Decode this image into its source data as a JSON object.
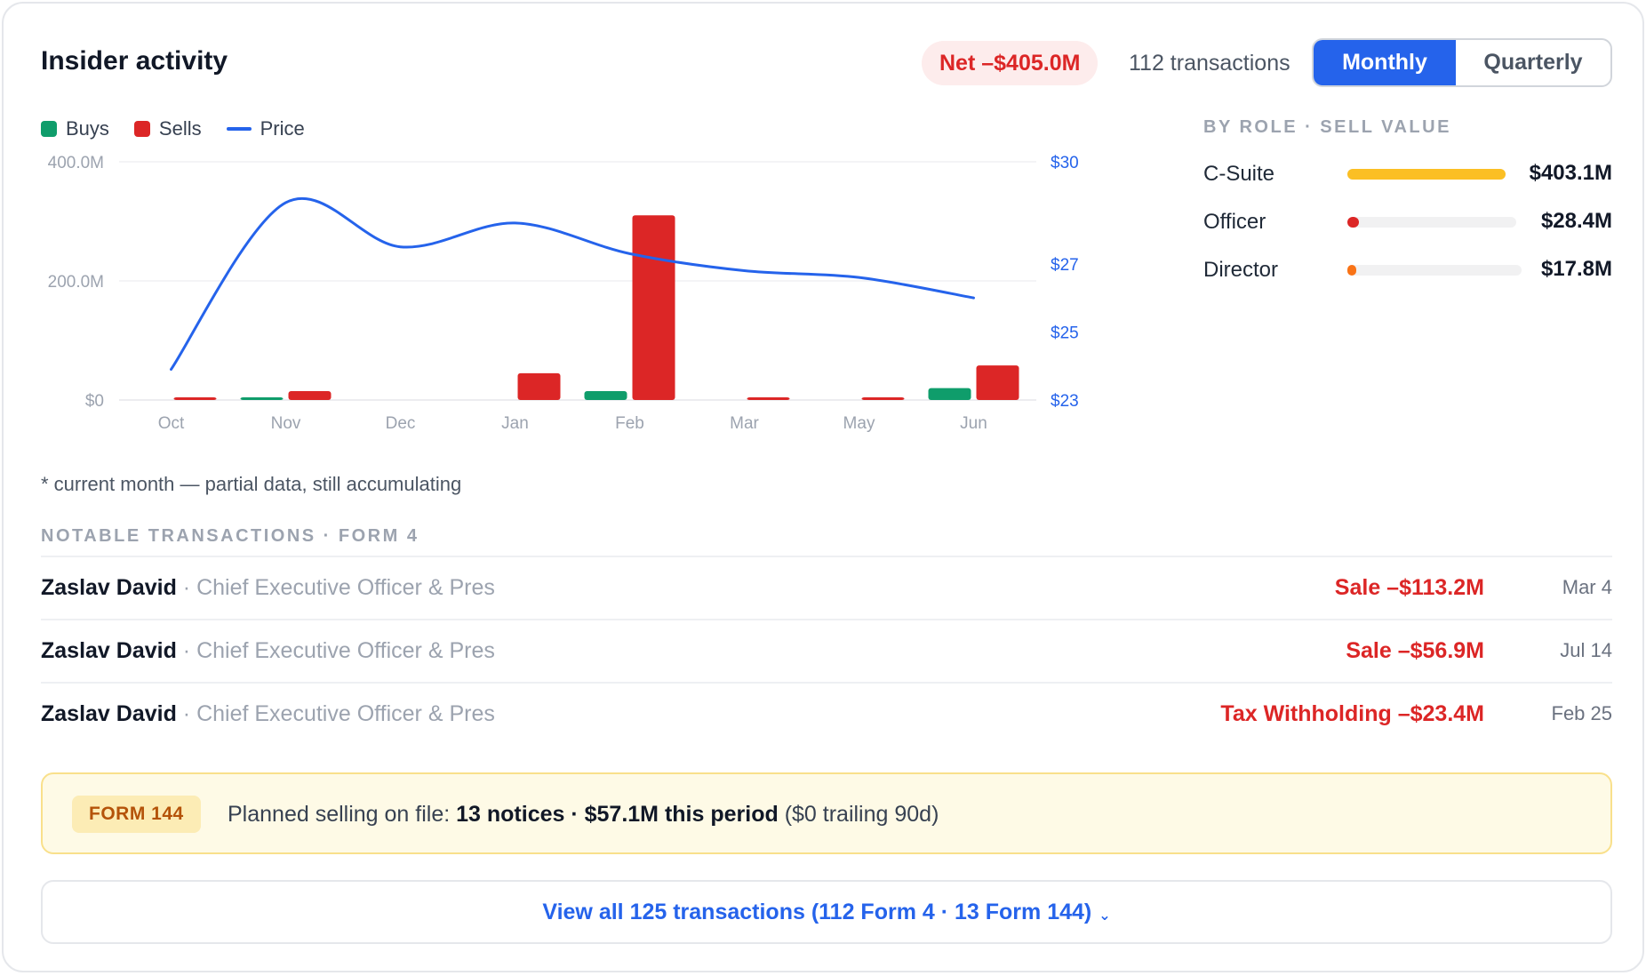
{
  "header": {
    "title": "Insider activity",
    "net": "Net –$405.0M",
    "transactions": "112 transactions",
    "toggle": {
      "active": "Monthly",
      "inactive": "Quarterly"
    }
  },
  "legend": {
    "buys": "Buys",
    "sells": "Sells",
    "price": "Price"
  },
  "chart_data": {
    "type": "bar",
    "categories": [
      "Oct",
      "Nov",
      "Dec",
      "Jan",
      "Feb",
      "Mar",
      "May",
      "Jun"
    ],
    "series": [
      {
        "name": "Buys",
        "color": "#0f9d6b",
        "values": [
          0,
          3,
          0,
          0,
          15,
          0,
          0,
          20
        ]
      },
      {
        "name": "Sells",
        "color": "#dc2626",
        "values": [
          3,
          15,
          0,
          45,
          310,
          4,
          4,
          58
        ]
      }
    ],
    "line": {
      "name": "Price",
      "color": "#2563eb",
      "values": [
        23.9,
        28.8,
        27.5,
        28.2,
        27.3,
        26.8,
        26.6,
        26.0
      ]
    },
    "y_left": {
      "ticks": [
        "400.0M",
        "200.0M",
        "$0"
      ],
      "ylim": [
        0,
        400
      ]
    },
    "y_right": {
      "ticks": [
        "$30",
        "$27",
        "$25",
        "$23"
      ]
    },
    "grid": true,
    "legend_position": "top-left"
  },
  "footnote": "* current month — partial data, still accumulating",
  "by_role": {
    "heading": "BY ROLE · SELL VALUE",
    "rows": [
      {
        "name": "C-Suite",
        "value": "$403.1M",
        "share": 1.0,
        "color": "#fbbf24"
      },
      {
        "name": "Officer",
        "value": "$28.4M",
        "share": 0.07,
        "color": "#dc2626"
      },
      {
        "name": "Director",
        "value": "$17.8M",
        "share": 0.044,
        "color": "#f97316"
      }
    ]
  },
  "notable": {
    "heading": "NOTABLE TRANSACTIONS · FORM 4",
    "rows": [
      {
        "name": "Zaslav David",
        "role": " · Chief Executive Officer & Pres",
        "amount": "Sale –$113.2M",
        "date": "Mar 4"
      },
      {
        "name": "Zaslav David",
        "role": " · Chief Executive Officer & Pres",
        "amount": "Sale –$56.9M",
        "date": "Jul 14"
      },
      {
        "name": "Zaslav David",
        "role": " · Chief Executive Officer & Pres",
        "amount": "Tax Withholding –$23.4M",
        "date": "Feb 25"
      }
    ]
  },
  "form144": {
    "badge": "FORM 144",
    "lead": "Planned selling on file: ",
    "strong": "13 notices · $57.1M this period",
    "tail": " ($0 trailing 90d)"
  },
  "view_all": {
    "label": "View all 125 transactions (112 Form 4 · 13 Form 144)",
    "chevron": "chevron-down-icon"
  }
}
